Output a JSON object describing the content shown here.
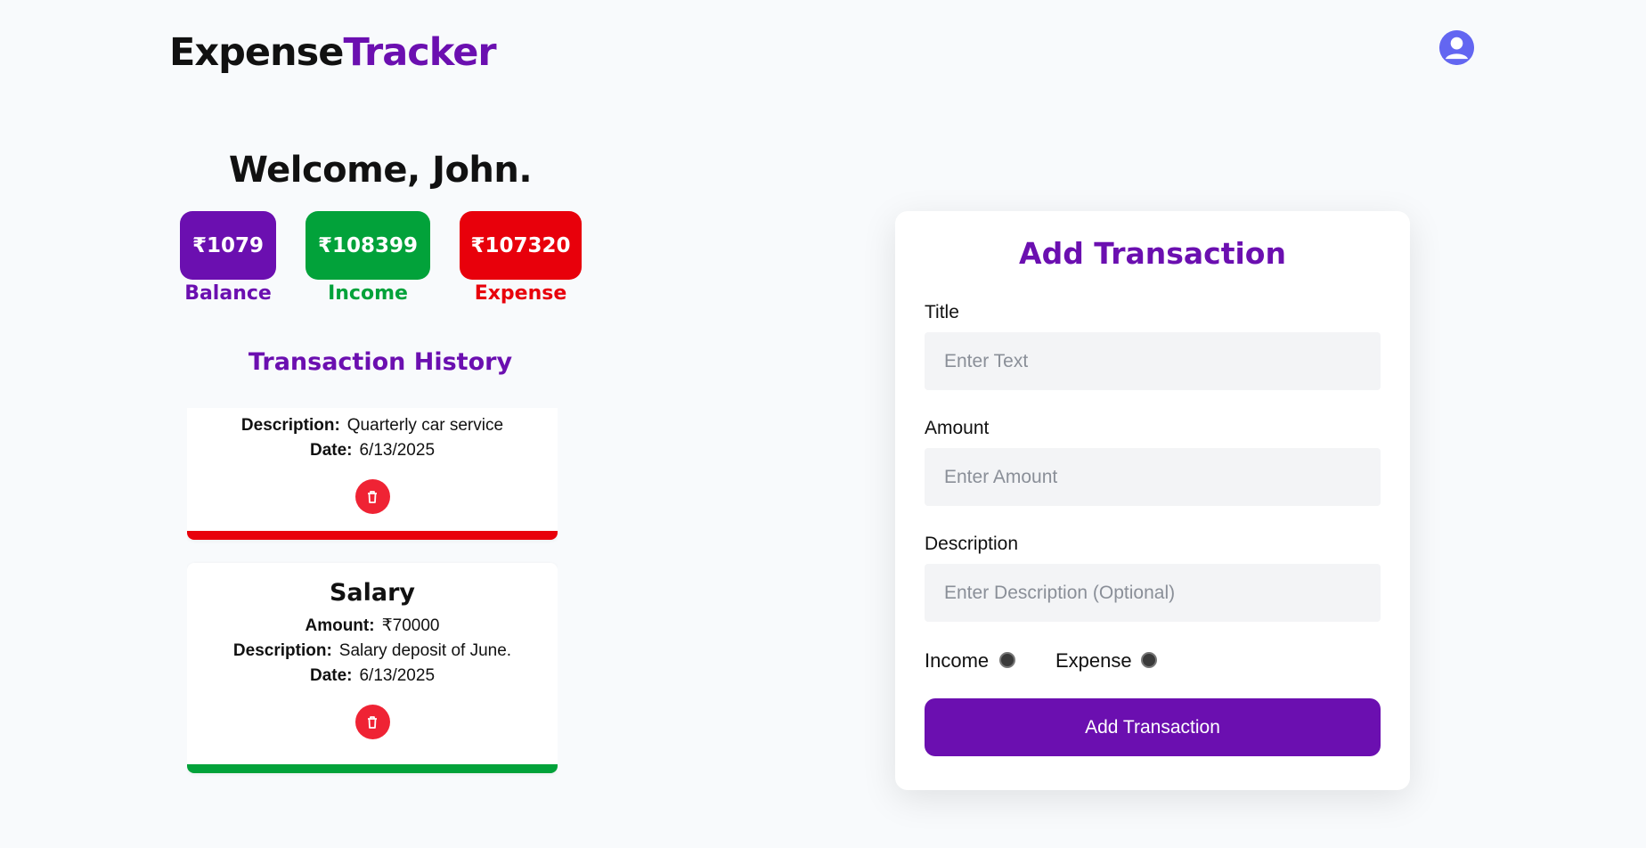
{
  "header": {
    "logo_part1": "Expense",
    "logo_part2": "Tracker",
    "avatar_icon": "user-avatar-icon"
  },
  "summary": {
    "welcome": "Welcome, John.",
    "balance_value": "₹1079",
    "balance_label": "Balance",
    "income_value": "₹108399",
    "income_label": "Income",
    "expense_value": "₹107320",
    "expense_label": "Expense"
  },
  "history": {
    "title": "Transaction History",
    "items": [
      {
        "type": "expense",
        "description_label": "Description:",
        "description": "Quarterly car service",
        "date_label": "Date:",
        "date": "6/13/2025",
        "delete_icon": "trash-icon"
      },
      {
        "type": "income",
        "title": "Salary",
        "amount_label": "Amount:",
        "amount": "₹70000",
        "description_label": "Description:",
        "description": "Salary deposit of June.",
        "date_label": "Date:",
        "date": "6/13/2025",
        "delete_icon": "trash-icon"
      }
    ]
  },
  "form": {
    "title": "Add Transaction",
    "title_label": "Title",
    "title_placeholder": "Enter Text",
    "amount_label": "Amount",
    "amount_placeholder": "Enter Amount",
    "description_label": "Description",
    "description_placeholder": "Enter Description (Optional)",
    "income_radio": "Income",
    "expense_radio": "Expense",
    "submit_label": "Add Transaction"
  },
  "colors": {
    "primary": "#6b0fb0",
    "income": "#02a23a",
    "expense": "#e8000b",
    "delete": "#ef2334",
    "avatar": "#6366f1"
  }
}
